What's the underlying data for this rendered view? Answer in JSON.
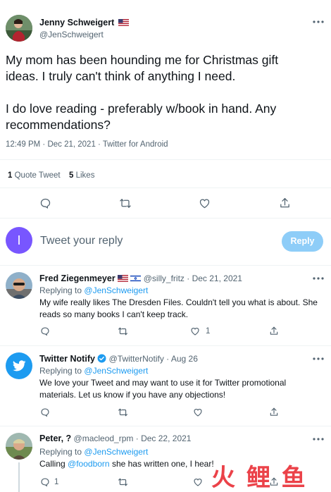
{
  "main_tweet": {
    "author_name": "Jenny Schweigert",
    "author_handle": "@JenSchweigert",
    "text_line1": "My mom has been hounding me for Christmas gift",
    "text_line2": "ideas. I truly can't think of anything I need.",
    "text_line3": "I do love reading - preferably w/book in hand. Any",
    "text_line4": "recommendations?",
    "meta": "12:49 PM · Dec 21, 2021 · Twitter for Android",
    "quote_count": "1",
    "quote_label": "Quote Tweet",
    "likes_count": "5",
    "likes_label": "Likes"
  },
  "composer": {
    "avatar_letter": "I",
    "placeholder": "Tweet your reply",
    "reply_label": "Reply"
  },
  "replies": [
    {
      "name": "Fred Ziegenmeyer",
      "handle": "@silly_fritz",
      "date": "· Dec 21, 2021",
      "replying_prefix": "Replying to",
      "replying_to": "@JenSchweigert",
      "text_line1": "My wife really likes The Dresden Files. Couldn't tell you what is about. She",
      "text_line2": "reads so many books I can't keep track.",
      "like_count": "1"
    },
    {
      "name": "Twitter Notify",
      "handle": "@TwitterNotify",
      "date": "· Aug 26",
      "replying_prefix": "Replying to",
      "replying_to": "@JenSchweigert",
      "text_line1": "We love your Tweet and may want to use it for Twitter promotional",
      "text_line2": "materials. Let us know if you have any objections!"
    },
    {
      "name": "Peter, ?",
      "handle": "@macleod_rpm",
      "date": "· Dec 22, 2021",
      "replying_prefix": "Replying to",
      "replying_to": "@JenSchweigert",
      "text_prefix": "Calling",
      "text_mention": "@foodborn",
      "text_suffix": "she has written one, I hear!",
      "reply_count": "1"
    }
  ],
  "watermark_text": "火 鲤 鱼",
  "colors": {
    "accent": "#1d9bf0",
    "reply_button": "#8ecdf8",
    "composer_avatar": "#7856ff",
    "text": "#0f1419",
    "muted": "#536471"
  }
}
